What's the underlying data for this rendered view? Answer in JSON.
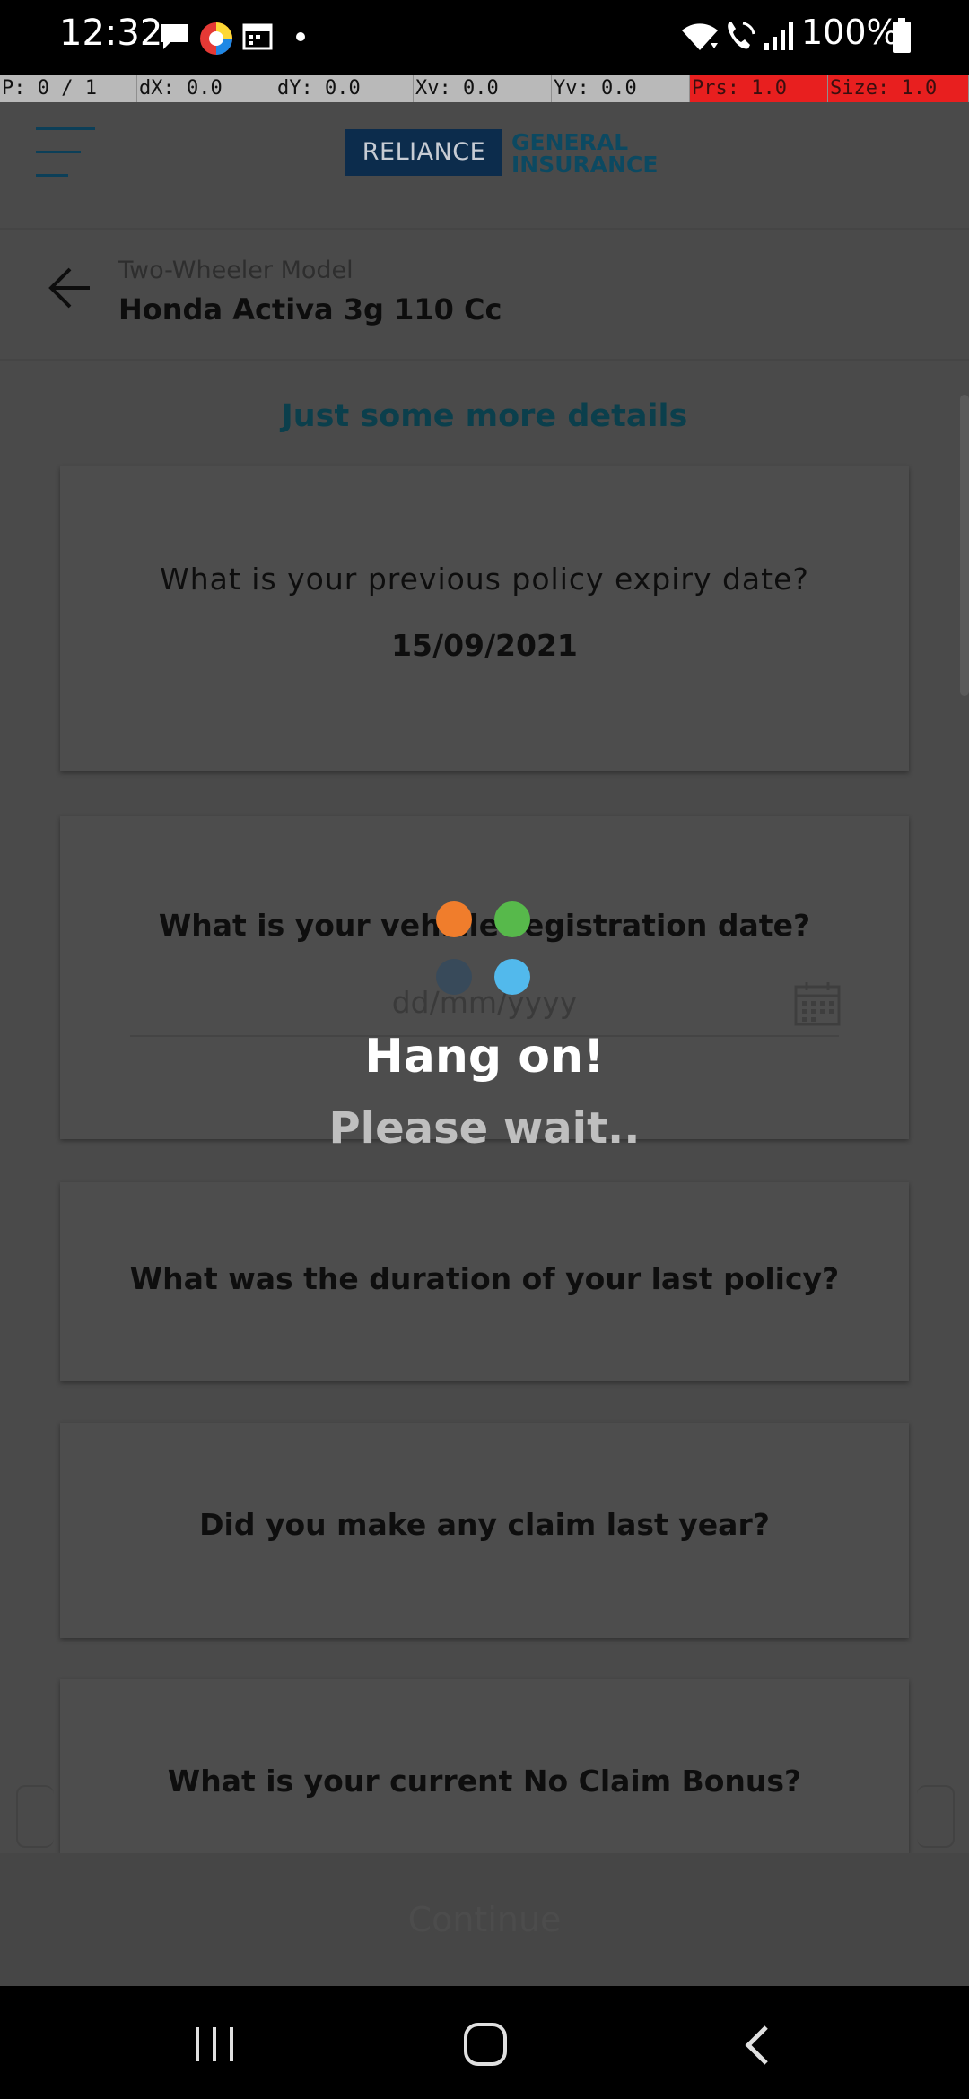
{
  "status_bar": {
    "time": "12:32",
    "battery": "100%",
    "notification_icons": [
      "message-icon",
      "app-icon",
      "calendar-icon",
      "dot-icon"
    ],
    "system_icons": [
      "wifi-icon",
      "wifi-call-icon",
      "signal-icon",
      "battery-icon"
    ]
  },
  "debug_bar": {
    "p": "P: 0 / 1",
    "dx": "dX: 0.0",
    "dy": "dY: 0.0",
    "xv": "Xv: 0.0",
    "yv": "Yv: 0.0",
    "prs": "Prs: 1.0",
    "size": "Size: 1.0"
  },
  "header": {
    "logo_left": "RELIANCE",
    "logo_right_line1": "GENERAL",
    "logo_right_line2": "INSURANCE"
  },
  "subheader": {
    "caption": "Two-Wheeler Model",
    "model": "Honda Activa 3g 110 Cc"
  },
  "main": {
    "section_title": "Just some more details",
    "cards": [
      {
        "question": "What is your previous policy expiry date?",
        "value": "15/09/2021"
      },
      {
        "question": "What is your vehicle registration date?",
        "placeholder": "dd/mm/yyyy"
      },
      {
        "question": "What was the duration of your last policy?"
      },
      {
        "question": "Did you make any claim last year?"
      },
      {
        "question": "What is your current No Claim Bonus?"
      }
    ]
  },
  "footer": {
    "continue_label": "Continue"
  },
  "loader": {
    "title": "Hang on!",
    "subtitle": "Please wait..",
    "dot_colors": [
      "#f07d2c",
      "#57b94b",
      "#384a5a",
      "#52b9ec"
    ]
  },
  "colors": {
    "overlay": "#4a4a4a",
    "brand_navy": "#0c2c4c",
    "brand_teal": "#0c4961"
  }
}
